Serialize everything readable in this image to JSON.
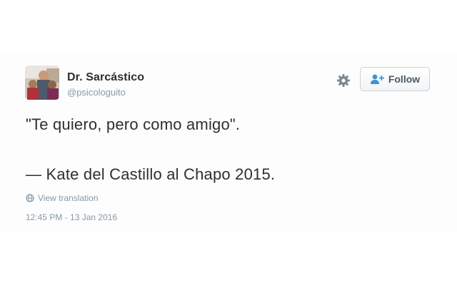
{
  "tweet": {
    "display_name": "Dr. Sarcástico",
    "handle": "@psicologuito",
    "text_line_1": "\"Te quiero, pero como amigo\".",
    "text_line_2": "— Kate del Castillo al Chapo 2015.",
    "view_translation_label": "View translation",
    "timestamp": "12:45 PM - 13 Jan 2016"
  },
  "actions": {
    "follow_label": "Follow",
    "settings_icon": "gear-icon",
    "follow_icon": "add-user-icon",
    "translation_icon": "globe-icon"
  },
  "colors": {
    "name": "#292f33",
    "meta_text": "#8899a6",
    "follow_icon": "#3b94d9",
    "button_text": "#4d5963"
  }
}
